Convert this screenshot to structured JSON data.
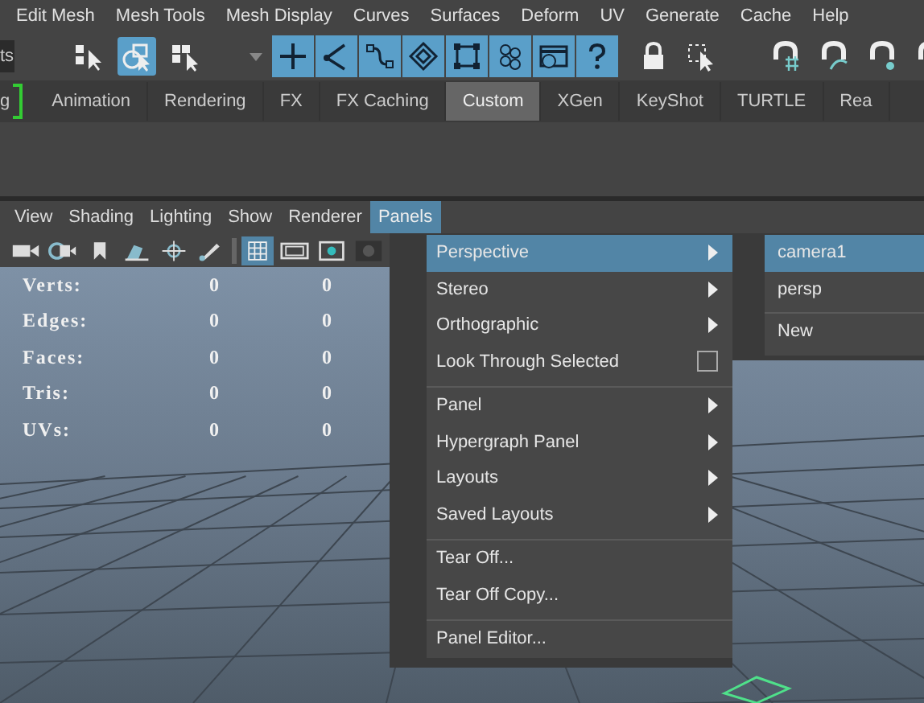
{
  "menu_bar": {
    "items": [
      "Edit Mesh",
      "Mesh Tools",
      "Mesh Display",
      "Curves",
      "Surfaces",
      "Deform",
      "UV",
      "Generate",
      "Cache",
      "Help"
    ]
  },
  "toolbar": {
    "field_value": "ts"
  },
  "shelf_tabs": [
    {
      "label": "g",
      "selected": false
    },
    {
      "label": "Animation",
      "selected": false
    },
    {
      "label": "Rendering",
      "selected": false
    },
    {
      "label": "FX",
      "selected": false
    },
    {
      "label": "FX Caching",
      "selected": false
    },
    {
      "label": "Custom",
      "selected": true
    },
    {
      "label": "XGen",
      "selected": false
    },
    {
      "label": "KeyShot",
      "selected": false
    },
    {
      "label": "TURTLE",
      "selected": false
    },
    {
      "label": "Rea",
      "selected": false
    }
  ],
  "panel_menu": [
    {
      "label": "View",
      "selected": false
    },
    {
      "label": "Shading",
      "selected": false
    },
    {
      "label": "Lighting",
      "selected": false
    },
    {
      "label": "Show",
      "selected": false
    },
    {
      "label": "Renderer",
      "selected": false
    },
    {
      "label": "Panels",
      "selected": true
    }
  ],
  "hud": [
    {
      "label": "Verts:",
      "value_1": "0",
      "value_2": "0"
    },
    {
      "label": "Edges:",
      "value_1": "0",
      "value_2": "0"
    },
    {
      "label": "Faces:",
      "value_1": "0",
      "value_2": "0"
    },
    {
      "label": "Tris:",
      "value_1": "0",
      "value_2": "0"
    },
    {
      "label": "UVs:",
      "value_1": "0",
      "value_2": "0"
    }
  ],
  "panels_dropdown": {
    "groups": [
      [
        {
          "label": "Perspective",
          "kind": "submenu",
          "selected": true
        },
        {
          "label": "Stereo",
          "kind": "submenu",
          "selected": false
        },
        {
          "label": "Orthographic",
          "kind": "submenu",
          "selected": false
        },
        {
          "label": "Look Through Selected",
          "kind": "checkbox",
          "selected": false,
          "checked": false
        }
      ],
      [
        {
          "label": "Panel",
          "kind": "submenu",
          "selected": false
        },
        {
          "label": "Hypergraph Panel",
          "kind": "submenu",
          "selected": false
        },
        {
          "label": "Layouts",
          "kind": "submenu",
          "selected": false
        },
        {
          "label": "Saved Layouts",
          "kind": "submenu",
          "selected": false
        }
      ],
      [
        {
          "label": "Tear Off...",
          "kind": "action",
          "selected": false
        },
        {
          "label": "Tear Off Copy...",
          "kind": "action",
          "selected": false
        }
      ],
      [
        {
          "label": "Panel Editor...",
          "kind": "action",
          "selected": false
        }
      ]
    ]
  },
  "perspective_submenu": {
    "groups": [
      [
        {
          "label": "camera1",
          "selected": true
        },
        {
          "label": "persp",
          "selected": false
        }
      ],
      [
        {
          "label": "New",
          "selected": false
        }
      ]
    ]
  }
}
